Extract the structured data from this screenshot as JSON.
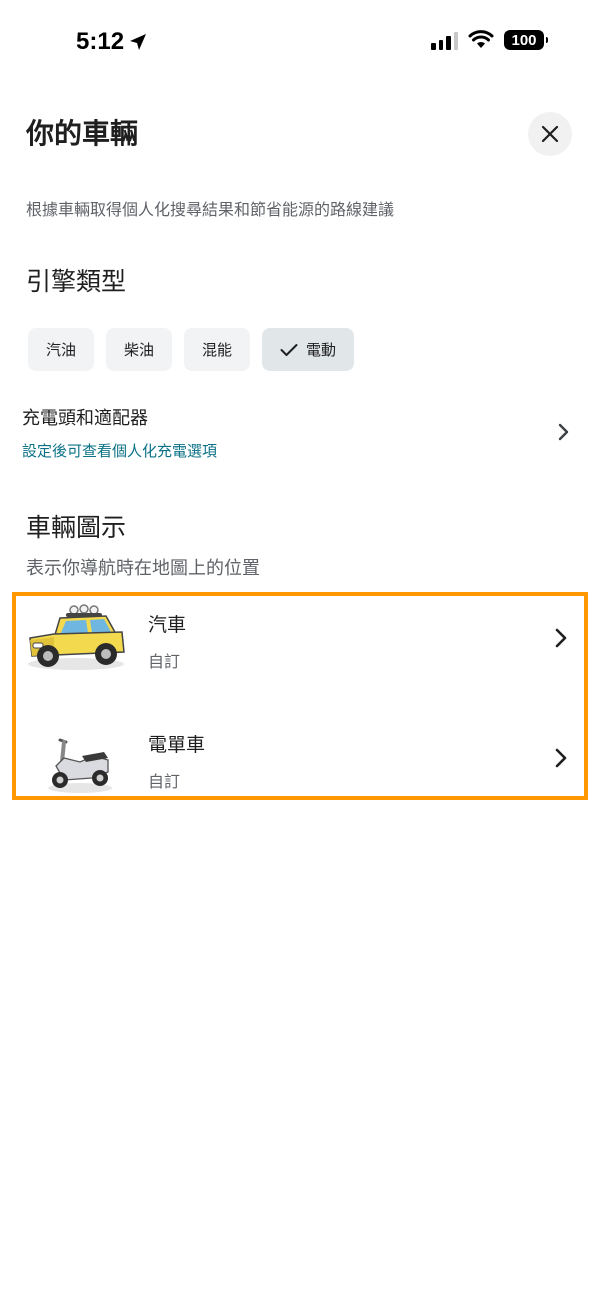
{
  "status_bar": {
    "time": "5:12",
    "battery": "100"
  },
  "header": {
    "title": "你的車輛",
    "subtitle": "根據車輛取得個人化搜尋結果和節省能源的路線建議"
  },
  "engine": {
    "title": "引擎類型",
    "options": [
      {
        "label": "汽油",
        "selected": false
      },
      {
        "label": "柴油",
        "selected": false
      },
      {
        "label": "混能",
        "selected": false
      },
      {
        "label": "電動",
        "selected": true
      }
    ]
  },
  "charger": {
    "title": "充電頭和適配器",
    "subtitle": "設定後可查看個人化充電選項"
  },
  "vehicle_icons": {
    "title": "車輛圖示",
    "subtitle": "表示你導航時在地圖上的位置",
    "items": [
      {
        "name": "汽車",
        "desc": "自訂",
        "icon": "yellow-truck-icon"
      },
      {
        "name": "電單車",
        "desc": "自訂",
        "icon": "scooter-icon"
      }
    ]
  },
  "colors": {
    "highlight": "#ff9800",
    "link": "#0b7285",
    "chip_bg": "#f1f3f4"
  }
}
